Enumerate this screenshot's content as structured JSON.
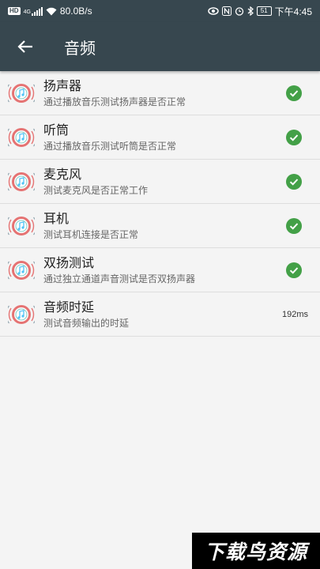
{
  "status_bar": {
    "hd": "HD",
    "network": "4G",
    "speed": "80.0B/s",
    "nfc": "N",
    "battery": "51",
    "time": "下午4:45"
  },
  "toolbar": {
    "title": "音频"
  },
  "items": [
    {
      "title": "扬声器",
      "subtitle": "通过播放音乐测试扬声器是否正常",
      "status": "check-icon"
    },
    {
      "title": "听筒",
      "subtitle": "通过播放音乐测试听筒是否正常",
      "status": "check-icon"
    },
    {
      "title": "麦克风",
      "subtitle": "测试麦克风是否正常工作",
      "status": "check-icon"
    },
    {
      "title": "耳机",
      "subtitle": "测试耳机连接是否正常",
      "status": "check-icon"
    },
    {
      "title": "双扬测试",
      "subtitle": "通过独立通道声音测试是否双扬声器",
      "status": "check-icon"
    },
    {
      "title": "音频时延",
      "subtitle": "测试音频输出的时延",
      "result": "192ms"
    }
  ],
  "colors": {
    "toolbar": "#37474f",
    "check": "#43a047",
    "icon_ring": "#e57373"
  },
  "watermark": {
    "text": "下载鸟资源"
  }
}
